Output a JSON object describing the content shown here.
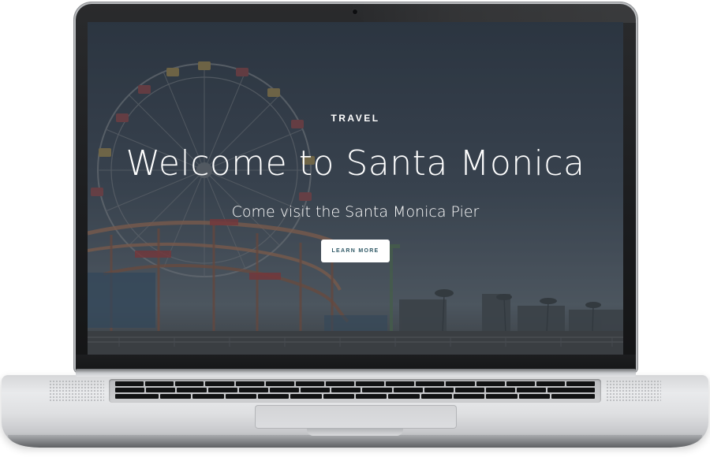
{
  "hero": {
    "eyebrow": "TRAVEL",
    "title": "Welcome to Santa Monica",
    "subtitle": "Come visit the Santa Monica Pier",
    "cta_label": "LEARN MORE"
  },
  "colors": {
    "overlay": "#1e2630",
    "sky": "#3f4a57",
    "cta_text": "#2f5966",
    "cta_background": "#ffffff",
    "text": "#ffffff"
  },
  "icons": {
    "camera": "webcam-icon"
  }
}
